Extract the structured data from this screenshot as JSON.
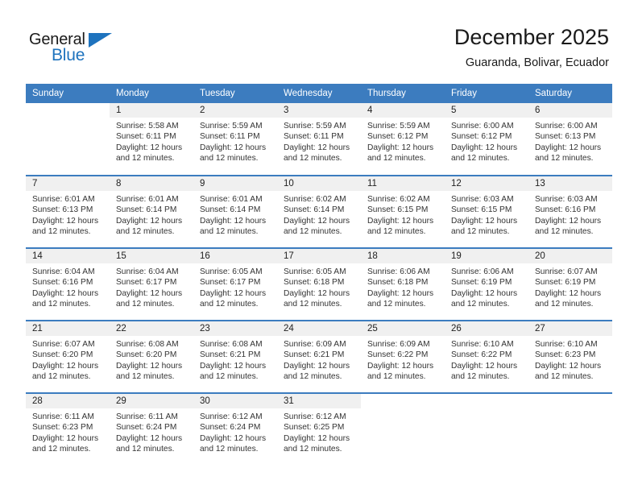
{
  "brand": {
    "name_dark": "General",
    "name_blue": "Blue",
    "logo_icon": "triangle-icon",
    "accent_color": "#1e73be"
  },
  "header": {
    "title": "December 2025",
    "subtitle": "Guaranda, Bolivar, Ecuador"
  },
  "theme": {
    "header_bg": "#3c7cbf",
    "header_text": "#ffffff",
    "daynum_bg": "#f0f0f0",
    "cell_text": "#333333",
    "week_divider": "#3c7cbf"
  },
  "weekdays": [
    "Sunday",
    "Monday",
    "Tuesday",
    "Wednesday",
    "Thursday",
    "Friday",
    "Saturday"
  ],
  "weeks": [
    [
      {
        "day": "",
        "sunrise": "",
        "sunset": "",
        "daylight_a": "",
        "daylight_b": "",
        "blank": true
      },
      {
        "day": "1",
        "sunrise": "Sunrise: 5:58 AM",
        "sunset": "Sunset: 6:11 PM",
        "daylight_a": "Daylight: 12 hours",
        "daylight_b": "and 12 minutes."
      },
      {
        "day": "2",
        "sunrise": "Sunrise: 5:59 AM",
        "sunset": "Sunset: 6:11 PM",
        "daylight_a": "Daylight: 12 hours",
        "daylight_b": "and 12 minutes."
      },
      {
        "day": "3",
        "sunrise": "Sunrise: 5:59 AM",
        "sunset": "Sunset: 6:11 PM",
        "daylight_a": "Daylight: 12 hours",
        "daylight_b": "and 12 minutes."
      },
      {
        "day": "4",
        "sunrise": "Sunrise: 5:59 AM",
        "sunset": "Sunset: 6:12 PM",
        "daylight_a": "Daylight: 12 hours",
        "daylight_b": "and 12 minutes."
      },
      {
        "day": "5",
        "sunrise": "Sunrise: 6:00 AM",
        "sunset": "Sunset: 6:12 PM",
        "daylight_a": "Daylight: 12 hours",
        "daylight_b": "and 12 minutes."
      },
      {
        "day": "6",
        "sunrise": "Sunrise: 6:00 AM",
        "sunset": "Sunset: 6:13 PM",
        "daylight_a": "Daylight: 12 hours",
        "daylight_b": "and 12 minutes."
      }
    ],
    [
      {
        "day": "7",
        "sunrise": "Sunrise: 6:01 AM",
        "sunset": "Sunset: 6:13 PM",
        "daylight_a": "Daylight: 12 hours",
        "daylight_b": "and 12 minutes."
      },
      {
        "day": "8",
        "sunrise": "Sunrise: 6:01 AM",
        "sunset": "Sunset: 6:14 PM",
        "daylight_a": "Daylight: 12 hours",
        "daylight_b": "and 12 minutes."
      },
      {
        "day": "9",
        "sunrise": "Sunrise: 6:01 AM",
        "sunset": "Sunset: 6:14 PM",
        "daylight_a": "Daylight: 12 hours",
        "daylight_b": "and 12 minutes."
      },
      {
        "day": "10",
        "sunrise": "Sunrise: 6:02 AM",
        "sunset": "Sunset: 6:14 PM",
        "daylight_a": "Daylight: 12 hours",
        "daylight_b": "and 12 minutes."
      },
      {
        "day": "11",
        "sunrise": "Sunrise: 6:02 AM",
        "sunset": "Sunset: 6:15 PM",
        "daylight_a": "Daylight: 12 hours",
        "daylight_b": "and 12 minutes."
      },
      {
        "day": "12",
        "sunrise": "Sunrise: 6:03 AM",
        "sunset": "Sunset: 6:15 PM",
        "daylight_a": "Daylight: 12 hours",
        "daylight_b": "and 12 minutes."
      },
      {
        "day": "13",
        "sunrise": "Sunrise: 6:03 AM",
        "sunset": "Sunset: 6:16 PM",
        "daylight_a": "Daylight: 12 hours",
        "daylight_b": "and 12 minutes."
      }
    ],
    [
      {
        "day": "14",
        "sunrise": "Sunrise: 6:04 AM",
        "sunset": "Sunset: 6:16 PM",
        "daylight_a": "Daylight: 12 hours",
        "daylight_b": "and 12 minutes."
      },
      {
        "day": "15",
        "sunrise": "Sunrise: 6:04 AM",
        "sunset": "Sunset: 6:17 PM",
        "daylight_a": "Daylight: 12 hours",
        "daylight_b": "and 12 minutes."
      },
      {
        "day": "16",
        "sunrise": "Sunrise: 6:05 AM",
        "sunset": "Sunset: 6:17 PM",
        "daylight_a": "Daylight: 12 hours",
        "daylight_b": "and 12 minutes."
      },
      {
        "day": "17",
        "sunrise": "Sunrise: 6:05 AM",
        "sunset": "Sunset: 6:18 PM",
        "daylight_a": "Daylight: 12 hours",
        "daylight_b": "and 12 minutes."
      },
      {
        "day": "18",
        "sunrise": "Sunrise: 6:06 AM",
        "sunset": "Sunset: 6:18 PM",
        "daylight_a": "Daylight: 12 hours",
        "daylight_b": "and 12 minutes."
      },
      {
        "day": "19",
        "sunrise": "Sunrise: 6:06 AM",
        "sunset": "Sunset: 6:19 PM",
        "daylight_a": "Daylight: 12 hours",
        "daylight_b": "and 12 minutes."
      },
      {
        "day": "20",
        "sunrise": "Sunrise: 6:07 AM",
        "sunset": "Sunset: 6:19 PM",
        "daylight_a": "Daylight: 12 hours",
        "daylight_b": "and 12 minutes."
      }
    ],
    [
      {
        "day": "21",
        "sunrise": "Sunrise: 6:07 AM",
        "sunset": "Sunset: 6:20 PM",
        "daylight_a": "Daylight: 12 hours",
        "daylight_b": "and 12 minutes."
      },
      {
        "day": "22",
        "sunrise": "Sunrise: 6:08 AM",
        "sunset": "Sunset: 6:20 PM",
        "daylight_a": "Daylight: 12 hours",
        "daylight_b": "and 12 minutes."
      },
      {
        "day": "23",
        "sunrise": "Sunrise: 6:08 AM",
        "sunset": "Sunset: 6:21 PM",
        "daylight_a": "Daylight: 12 hours",
        "daylight_b": "and 12 minutes."
      },
      {
        "day": "24",
        "sunrise": "Sunrise: 6:09 AM",
        "sunset": "Sunset: 6:21 PM",
        "daylight_a": "Daylight: 12 hours",
        "daylight_b": "and 12 minutes."
      },
      {
        "day": "25",
        "sunrise": "Sunrise: 6:09 AM",
        "sunset": "Sunset: 6:22 PM",
        "daylight_a": "Daylight: 12 hours",
        "daylight_b": "and 12 minutes."
      },
      {
        "day": "26",
        "sunrise": "Sunrise: 6:10 AM",
        "sunset": "Sunset: 6:22 PM",
        "daylight_a": "Daylight: 12 hours",
        "daylight_b": "and 12 minutes."
      },
      {
        "day": "27",
        "sunrise": "Sunrise: 6:10 AM",
        "sunset": "Sunset: 6:23 PM",
        "daylight_a": "Daylight: 12 hours",
        "daylight_b": "and 12 minutes."
      }
    ],
    [
      {
        "day": "28",
        "sunrise": "Sunrise: 6:11 AM",
        "sunset": "Sunset: 6:23 PM",
        "daylight_a": "Daylight: 12 hours",
        "daylight_b": "and 12 minutes."
      },
      {
        "day": "29",
        "sunrise": "Sunrise: 6:11 AM",
        "sunset": "Sunset: 6:24 PM",
        "daylight_a": "Daylight: 12 hours",
        "daylight_b": "and 12 minutes."
      },
      {
        "day": "30",
        "sunrise": "Sunrise: 6:12 AM",
        "sunset": "Sunset: 6:24 PM",
        "daylight_a": "Daylight: 12 hours",
        "daylight_b": "and 12 minutes."
      },
      {
        "day": "31",
        "sunrise": "Sunrise: 6:12 AM",
        "sunset": "Sunset: 6:25 PM",
        "daylight_a": "Daylight: 12 hours",
        "daylight_b": "and 12 minutes."
      },
      {
        "day": "",
        "sunrise": "",
        "sunset": "",
        "daylight_a": "",
        "daylight_b": "",
        "blank": true
      },
      {
        "day": "",
        "sunrise": "",
        "sunset": "",
        "daylight_a": "",
        "daylight_b": "",
        "blank": true
      },
      {
        "day": "",
        "sunrise": "",
        "sunset": "",
        "daylight_a": "",
        "daylight_b": "",
        "blank": true
      }
    ]
  ]
}
